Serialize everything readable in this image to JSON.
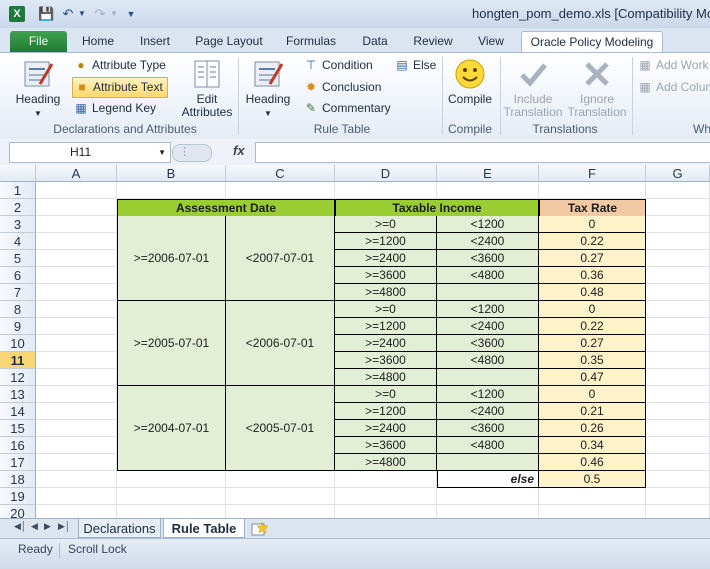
{
  "window": {
    "title": "hongten_pom_demo.xls  [Compatibility Mode"
  },
  "ribbon_tabs": [
    {
      "label": "File"
    },
    {
      "label": "Home"
    },
    {
      "label": "Insert"
    },
    {
      "label": "Page Layout"
    },
    {
      "label": "Formulas"
    },
    {
      "label": "Data"
    },
    {
      "label": "Review"
    },
    {
      "label": "View"
    },
    {
      "label": "Oracle Policy Modeling"
    }
  ],
  "ribbon": {
    "declarations": {
      "heading": "Heading",
      "attribute_type": "Attribute Type",
      "attribute_text": "Attribute Text",
      "legend_key": "Legend Key",
      "edit_attributes_line1": "Edit",
      "edit_attributes_line2": "Attributes",
      "group_label": "Declarations and Attributes"
    },
    "rule_table": {
      "heading": "Heading",
      "condition": "Condition",
      "conclusion": "Conclusion",
      "commentary": "Commentary",
      "else": "Else",
      "group_label": "Rule Table"
    },
    "compile": {
      "compile": "Compile",
      "group_label": "Compile"
    },
    "translations": {
      "include_line1": "Include",
      "include_line2": "Translation",
      "ignore_line1": "Ignore",
      "ignore_line2": "Translation",
      "group_label": "Translations"
    },
    "wh": {
      "add_work": "Add Work",
      "add_column": "Add Colum",
      "group_label": "Wh"
    }
  },
  "formula_bar": {
    "name_box": "H11",
    "fx": "fx",
    "formula": ""
  },
  "columns": [
    "A",
    "B",
    "C",
    "D",
    "E",
    "F",
    "G"
  ],
  "rows": [
    "1",
    "2",
    "3",
    "4",
    "5",
    "6",
    "7",
    "8",
    "9",
    "10",
    "11",
    "12",
    "13",
    "14",
    "15",
    "16",
    "17",
    "18",
    "19",
    "20"
  ],
  "selected_row": "11",
  "table": {
    "header_assessment": "Assessment Date",
    "header_income": "Taxable Income",
    "header_rate": "Tax Rate",
    "groups": [
      {
        "from": ">=2006-07-01",
        "to": "<2007-07-01",
        "rows": [
          {
            "min": ">=0",
            "max": "<1200",
            "rate": "0"
          },
          {
            "min": ">=1200",
            "max": "<2400",
            "rate": "0.22"
          },
          {
            "min": ">=2400",
            "max": "<3600",
            "rate": "0.27"
          },
          {
            "min": ">=3600",
            "max": "<4800",
            "rate": "0.36"
          },
          {
            "min": ">=4800",
            "max": "",
            "rate": "0.48"
          }
        ]
      },
      {
        "from": ">=2005-07-01",
        "to": "<2006-07-01",
        "rows": [
          {
            "min": ">=0",
            "max": "<1200",
            "rate": "0"
          },
          {
            "min": ">=1200",
            "max": "<2400",
            "rate": "0.22"
          },
          {
            "min": ">=2400",
            "max": "<3600",
            "rate": "0.27"
          },
          {
            "min": ">=3600",
            "max": "<4800",
            "rate": "0.35"
          },
          {
            "min": ">=4800",
            "max": "",
            "rate": "0.47"
          }
        ]
      },
      {
        "from": ">=2004-07-01",
        "to": "<2005-07-01",
        "rows": [
          {
            "min": ">=0",
            "max": "<1200",
            "rate": "0"
          },
          {
            "min": ">=1200",
            "max": "<2400",
            "rate": "0.21"
          },
          {
            "min": ">=2400",
            "max": "<3600",
            "rate": "0.26"
          },
          {
            "min": ">=3600",
            "max": "<4800",
            "rate": "0.34"
          },
          {
            "min": ">=4800",
            "max": "",
            "rate": "0.46"
          }
        ]
      }
    ],
    "else_label": "else",
    "else_rate": "0.5"
  },
  "sheet_tabs": [
    {
      "label": "Declarations"
    },
    {
      "label": "Rule Table"
    }
  ],
  "active_sheet": "Rule Table",
  "status": {
    "ready": "Ready",
    "scroll_lock": "Scroll Lock"
  }
}
